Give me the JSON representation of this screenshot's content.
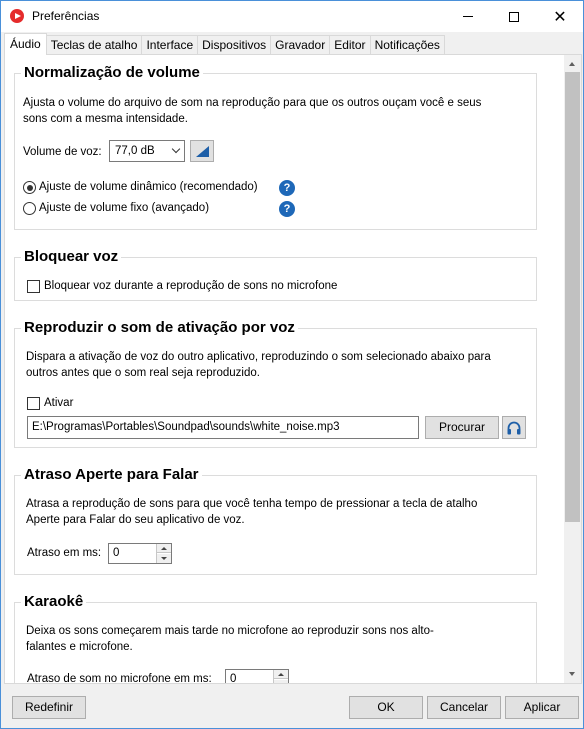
{
  "window": {
    "title": "Preferências",
    "accent_color": "#e52b2b"
  },
  "tabs": [
    {
      "label": "Áudio",
      "active": true
    },
    {
      "label": "Teclas de atalho"
    },
    {
      "label": "Interface"
    },
    {
      "label": "Dispositivos"
    },
    {
      "label": "Gravador"
    },
    {
      "label": "Editor"
    },
    {
      "label": "Notificações"
    }
  ],
  "normalization": {
    "title": "Normalização de volume",
    "description": "Ajusta o volume do arquivo de som na reprodução para que os outros ouçam você e seus sons com a mesma intensidade.",
    "voice_volume_label": "Volume de voz:",
    "voice_volume_value": "77,0 dB",
    "dynamic_label": "Ajuste de volume dinâmico (recomendado)",
    "fixed_label": "Ajuste de volume fixo (avançado)",
    "selected": "dynamic",
    "help_glyph": "?"
  },
  "block_voice": {
    "title": "Bloquear voz",
    "checkbox_label": "Bloquear voz durante a reprodução de sons no microfone",
    "checked": false
  },
  "activation_sound": {
    "title": "Reproduzir o som de ativação por voz",
    "description": "Dispara a ativação de voz do outro aplicativo, reproduzindo o som selecionado abaixo para outros antes que o som real seja reproduzido.",
    "enable_label": "Ativar",
    "checked": false,
    "file_path": "E:\\Programas\\Portables\\Soundpad\\sounds\\white_noise.mp3",
    "browse_label": "Procurar"
  },
  "push_to_talk": {
    "title": "Atraso Aperte para Falar",
    "description": "Atrasa a reprodução de sons para que você tenha tempo de pressionar a tecla de atalho Aperte para Falar do seu aplicativo de voz.",
    "delay_label": "Atraso em ms:",
    "delay_value": "0"
  },
  "karaoke": {
    "title": "Karaokê",
    "description": "Deixa os sons começarem mais tarde no microfone ao reproduzir sons nos alto-falantes e microfone.",
    "delay_label": "Atraso de som no microfone em ms:",
    "delay_value": "0"
  },
  "footer": {
    "reset_label": "Redefinir",
    "ok_label": "OK",
    "cancel_label": "Cancelar",
    "apply_label": "Aplicar"
  }
}
